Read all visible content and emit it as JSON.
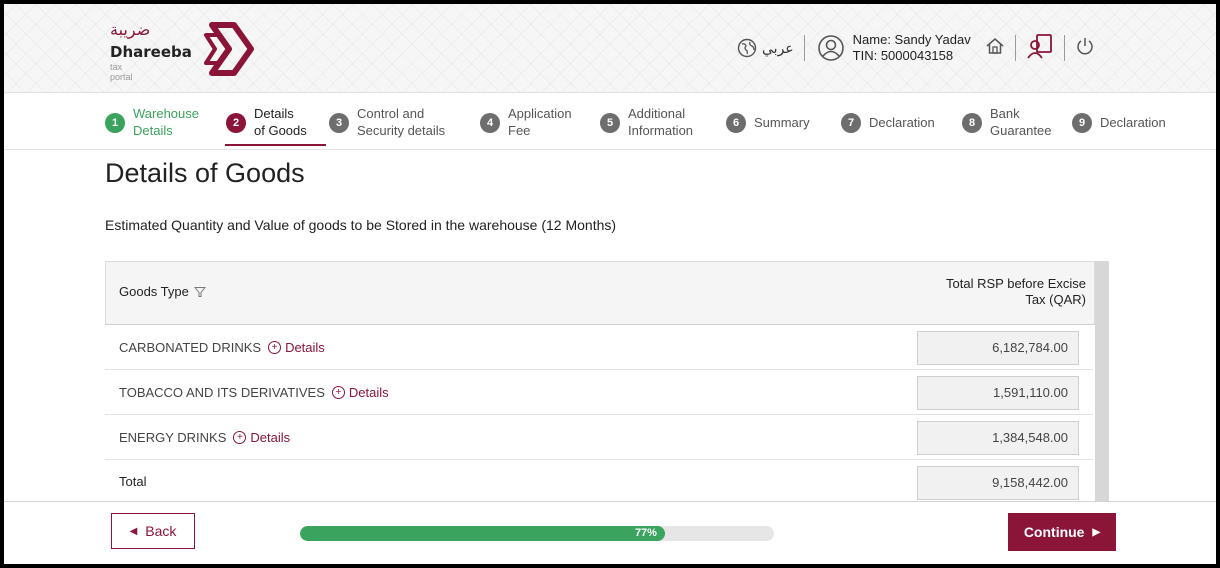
{
  "header": {
    "logo_arabic": "ضريبة",
    "logo_name": "Dhareeba",
    "logo_sub": "tax portal",
    "language_label": "عربي",
    "user_name": "Name: Sandy Yadav",
    "user_tin": "TIN: 5000043158",
    "icons": [
      "globe-icon",
      "user-icon",
      "home-icon",
      "book-user-icon",
      "power-icon"
    ]
  },
  "steps": [
    {
      "num": "1",
      "line1": "Warehouse",
      "line2": "Details",
      "state": "done"
    },
    {
      "num": "2",
      "line1": "Details",
      "line2": "of Goods",
      "state": "current"
    },
    {
      "num": "3",
      "line1": "Control and",
      "line2": "Security details",
      "state": "pending"
    },
    {
      "num": "4",
      "line1": "Application",
      "line2": "Fee",
      "state": "pending"
    },
    {
      "num": "5",
      "line1": "Additional",
      "line2": "Information",
      "state": "pending"
    },
    {
      "num": "6",
      "line1": "Summary",
      "line2": "",
      "state": "pending"
    },
    {
      "num": "7",
      "line1": "Declaration",
      "line2": "",
      "state": "pending"
    },
    {
      "num": "8",
      "line1": "Bank",
      "line2": "Guarantee",
      "state": "pending"
    },
    {
      "num": "9",
      "line1": "Declaration",
      "line2": "",
      "state": "pending"
    }
  ],
  "page": {
    "title": "Details of Goods",
    "subtitle": "Estimated Quantity and Value of goods to be Stored in the warehouse (12 Months)"
  },
  "table": {
    "col_goods": "Goods Type",
    "col_rsp_line1": "Total RSP before Excise",
    "col_rsp_line2": "Tax (QAR)",
    "details_label": "Details",
    "rows": [
      {
        "name": "CARBONATED DRINKS",
        "value": "6,182,784.00"
      },
      {
        "name": "TOBACCO AND ITS DERIVATIVES",
        "value": "1,591,110.00"
      },
      {
        "name": "ENERGY DRINKS",
        "value": "1,384,548.00"
      }
    ],
    "total_label": "Total",
    "total_value": "9,158,442.00"
  },
  "footer": {
    "back_label": "Back",
    "continue_label": "Continue",
    "progress_text": "77%",
    "progress_value": 0.77
  },
  "colors": {
    "brand": "#8a1538",
    "success": "#3aa35d"
  }
}
